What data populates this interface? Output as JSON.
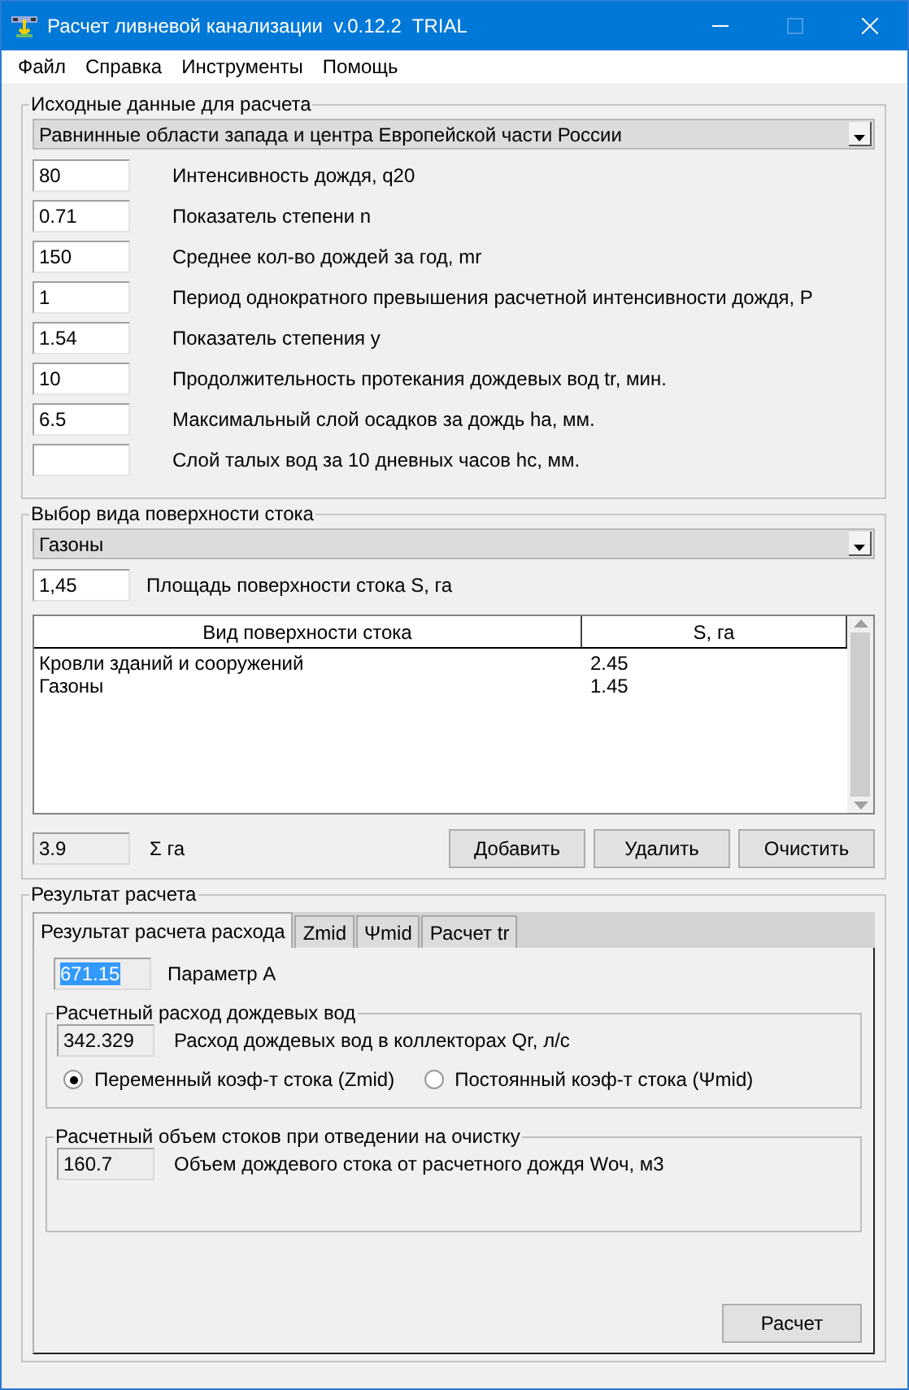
{
  "window": {
    "title": "Расчет ливневой канализации  v.0.12.2  TRIAL",
    "maximize_disabled": true
  },
  "menu": [
    "Файл",
    "Справка",
    "Инструменты",
    "Помощь"
  ],
  "input_data": {
    "title": "Исходные данные для расчета",
    "region": "Равнинные области запада и центра Европейской части России",
    "fields": [
      {
        "value": "80",
        "label": "Интенсивность дождя, q20"
      },
      {
        "value": "0.71",
        "label": "Показатель степени n"
      },
      {
        "value": "150",
        "label": "Среднее кол-во дождей за год, mr"
      },
      {
        "value": "1",
        "label": "Период однократного превышения расчетной интенсивности дождя, P"
      },
      {
        "value": "1.54",
        "label": "Показатель степения y"
      },
      {
        "value": "10",
        "label": "Продолжительность протекания дождевых вод tr, мин."
      },
      {
        "value": "6.5",
        "label": "Максимальный слой осадков за дождь ha, мм."
      },
      {
        "label": "Слой талых вод за 10 дневных часов hc, мм."
      }
    ]
  },
  "surface": {
    "title": "Выбор вида поверхности стока",
    "type": "Газоны",
    "area": {
      "value": "1,45",
      "label": "Площадь поверхности стока S, га"
    },
    "table": {
      "columns": [
        "Вид поверхности стока",
        "S, га"
      ],
      "rows": [
        [
          "Кровли зданий и сооружений",
          "2.45"
        ],
        [
          "Газоны",
          "1.45"
        ]
      ]
    },
    "sum": {
      "value": "3.9",
      "label": "Σ га",
      "readonly": true
    },
    "buttons": [
      "Добавить",
      "Удалить",
      "Очистить"
    ]
  },
  "result": {
    "title": "Результат расчета",
    "tabs": [
      {
        "label": "Результат расчета расхода",
        "selected": true
      },
      {
        "label": "Zmid",
        "selected": false
      },
      {
        "label": "Ψmid",
        "selected": false
      },
      {
        "label": "Расчет tr",
        "selected": false
      }
    ],
    "param_a": {
      "value": "671.15",
      "label": "Параметр A",
      "readonly": true,
      "highlighted": true
    },
    "flow": {
      "title": "Расчетный расход дождевых вод",
      "value": "342.329",
      "label": "Расход дождевых вод  в коллекторах Qr, л/с",
      "readonly": true,
      "options": [
        {
          "label": "Переменный коэф-т стока (Zmid)",
          "selected": true
        },
        {
          "label": "Постоянный коэф-т стока (Ψmid)",
          "selected": false
        }
      ]
    },
    "volume": {
      "title": "Расчетный объем стоков при отведении на очистку",
      "value": "160.7",
      "label": "Объем дождевого стока от расчетного дождя Wоч, м3",
      "readonly": true
    },
    "button": "Расчет"
  }
}
